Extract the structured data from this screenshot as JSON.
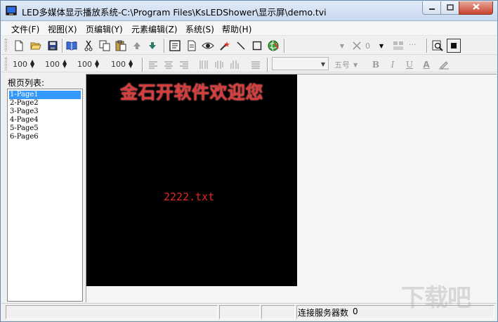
{
  "window": {
    "title": "LED多媒体显示播放系统-C:\\Program Files\\KsLEDShower\\显示屏\\demo.tvi",
    "icon": "led-app-icon"
  },
  "menu": [
    "文件(F)",
    "视图(X)",
    "页编辑(Y)",
    "元素编辑(Z)",
    "系统(S)",
    "帮助(H)"
  ],
  "toolbar1": {
    "icons": [
      "new-file-icon",
      "open-folder-icon",
      "save-icon",
      "book-icon",
      "cut-icon",
      "copy-icon",
      "paste-icon",
      "move-up-icon",
      "move-down-icon",
      "text-page-icon",
      "document-icon",
      "eye-icon",
      "effect-icon",
      "line-icon",
      "rectangle-icon",
      "globe-icon",
      "delete-icon",
      "zoom-icon",
      "frame-icon"
    ],
    "delete_value": "0",
    "more_label": "···"
  },
  "toolbar2": {
    "spin1": "100",
    "spin2": "100",
    "spin3": "100",
    "spin4": "100",
    "font_name": "",
    "font_size": "五号",
    "bold": "B",
    "italic": "I",
    "underline": "U",
    "font_color": "A"
  },
  "left_panel": {
    "label": "根页列表:",
    "pages": [
      "1-Page1",
      "2-Page2",
      "3-Page3",
      "4-Page4",
      "5-Page5",
      "6-Page6"
    ],
    "selected_index": 0
  },
  "canvas": {
    "title_text": "金石开软件欢迎您",
    "file_text": "2222.txt",
    "title_color": "#d93c3c",
    "background_color": "#000000"
  },
  "statusbar": {
    "label": "连接服务器数",
    "value": "0"
  },
  "watermark": "下载吧"
}
